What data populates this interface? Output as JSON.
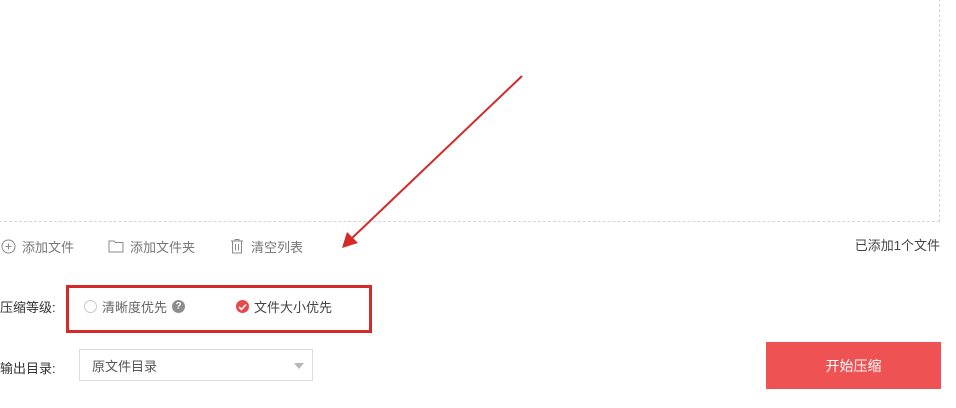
{
  "toolbar": {
    "add_file": "添加文件",
    "add_folder": "添加文件夹",
    "clear_list": "清空列表"
  },
  "status": {
    "added_count": "已添加1个文件"
  },
  "compression": {
    "label": "压缩等级:",
    "option_clarity": "清晰度优先",
    "option_size": "文件大小优先",
    "selected": "文件大小优先",
    "help_icon": "?"
  },
  "output": {
    "label": "输出目录:",
    "selected": "原文件目录"
  },
  "start_button": "开始压缩",
  "colors": {
    "accent": "#ee5253",
    "annotation": "#d42a2a"
  }
}
